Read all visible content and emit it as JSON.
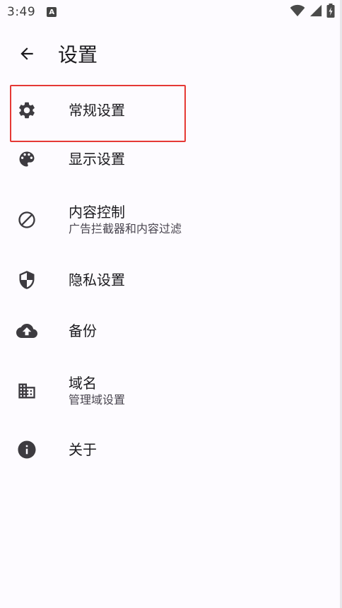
{
  "status_bar": {
    "time": "3:49",
    "notification_icon": "A"
  },
  "app_bar": {
    "title": "设置"
  },
  "items": [
    {
      "title": "常规设置",
      "subtitle": "",
      "icon": "gear-icon"
    },
    {
      "title": "显示设置",
      "subtitle": "",
      "icon": "palette-icon"
    },
    {
      "title": "内容控制",
      "subtitle": "广告拦截器和内容过滤",
      "icon": "block-icon"
    },
    {
      "title": "隐私设置",
      "subtitle": "",
      "icon": "shield-icon"
    },
    {
      "title": "备份",
      "subtitle": "",
      "icon": "cloud-upload-icon"
    },
    {
      "title": "域名",
      "subtitle": "管理域设置",
      "icon": "domain-icon"
    },
    {
      "title": "关于",
      "subtitle": "",
      "icon": "info-icon"
    }
  ],
  "colors": {
    "background": "#fdfbff",
    "icon": "#3d3b40",
    "highlight": "#e53935"
  }
}
